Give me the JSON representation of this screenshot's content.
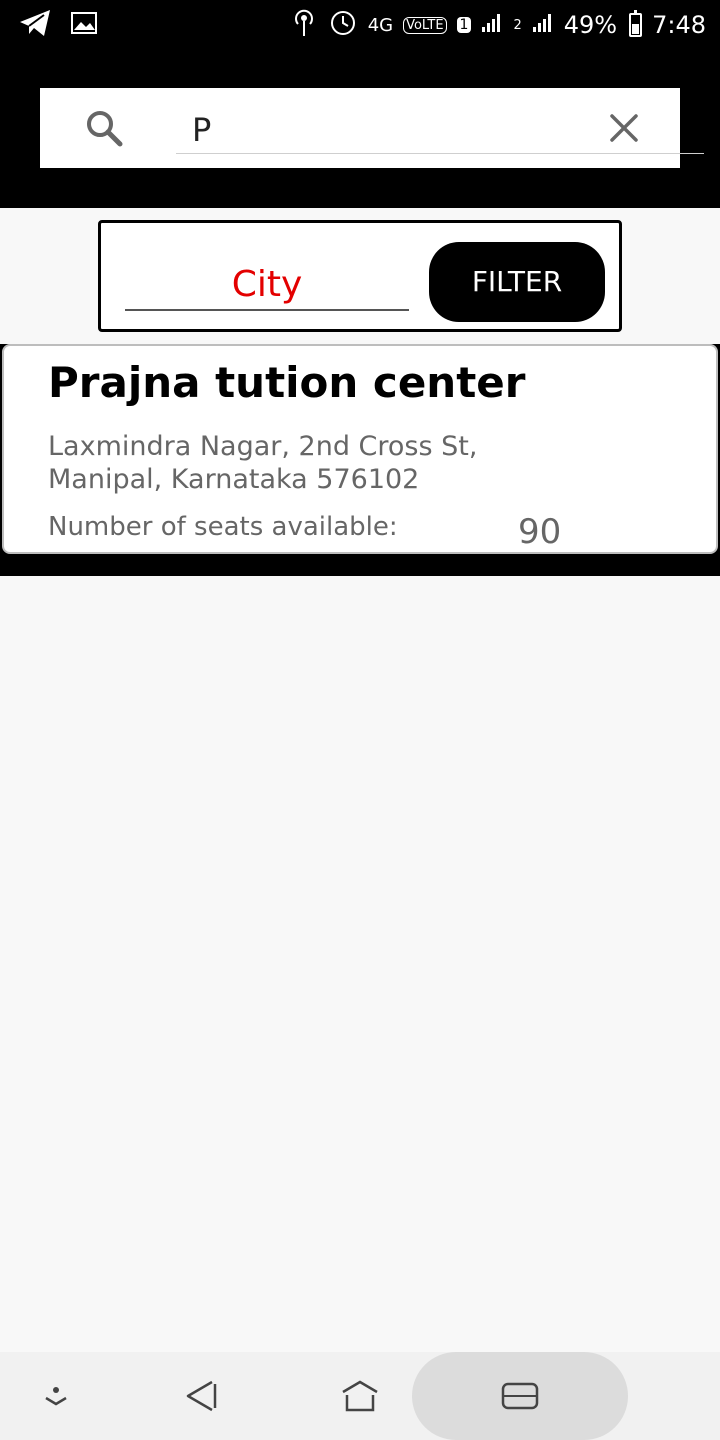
{
  "status_bar": {
    "sim_indicator": "1",
    "network": "4G",
    "volte": "VoLTE",
    "sim2_indicator": "2",
    "battery": "49%",
    "time": "7:48",
    "icons": [
      "telegram-icon",
      "gallery-icon",
      "hotspot-icon",
      "alarm-icon",
      "signal-icon"
    ]
  },
  "search": {
    "query": "P"
  },
  "filter": {
    "city_placeholder": "City",
    "button_label": "FILTER"
  },
  "results": [
    {
      "title": "Prajna tution center",
      "address_line1": "Laxmindra Nagar, 2nd Cross St,",
      "address_line2": "Manipal, Karnataka 576102",
      "seats_label": "Number of seats available:",
      "seats_value": "90"
    }
  ],
  "nav": {
    "buttons": [
      "hide-icon",
      "back-icon",
      "home-icon",
      "recents-icon"
    ]
  },
  "colors": {
    "accent": "#e30000",
    "bar": "#000000",
    "background": "#f8f8f8"
  }
}
